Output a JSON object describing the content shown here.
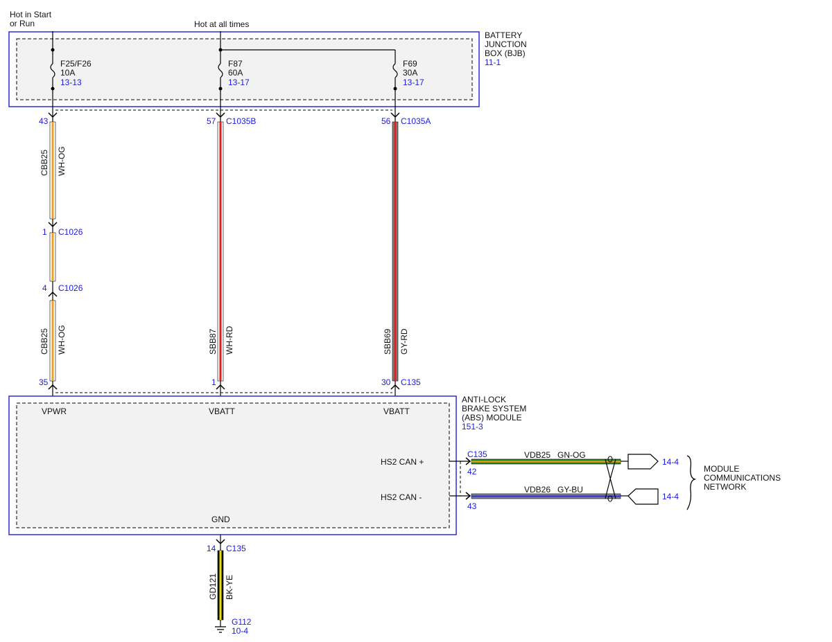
{
  "top_labels": {
    "hot_start_run_line1": "Hot in Start",
    "hot_start_run_line2": "or Run",
    "hot_all_times": "Hot at all times"
  },
  "bjb": {
    "name_line1": "BATTERY",
    "name_line2": "JUNCTION",
    "name_line3": "BOX (BJB)",
    "ref": "11-1",
    "fuses": [
      {
        "id": "F25/F26",
        "rating": "10A",
        "ref": "13-13"
      },
      {
        "id": "F87",
        "rating": "60A",
        "ref": "13-17"
      },
      {
        "id": "F69",
        "rating": "30A",
        "ref": "13-17"
      }
    ]
  },
  "circuits": [
    {
      "top_pin": "43",
      "connectors": [
        {
          "pin": "1",
          "name": "C1026"
        },
        {
          "pin": "4",
          "name": "C1026"
        }
      ],
      "upper": {
        "circuit": "CBB25",
        "color": "WH-OG"
      },
      "lower": {
        "circuit": "CBB25",
        "color": "WH-OG"
      },
      "bottom_pin": "35",
      "module_pin": "VPWR",
      "wire_colors": [
        "#ffffff",
        "#f0a020"
      ]
    },
    {
      "top_pin": "57",
      "top_connector": "C1035B",
      "lower": {
        "circuit": "SBB87",
        "color": "WH-RD"
      },
      "bottom_pin": "1",
      "module_pin": "VBATT",
      "wire_colors": [
        "#ffffff",
        "#e02020"
      ]
    },
    {
      "top_pin": "56",
      "top_connector": "C1035A",
      "lower": {
        "circuit": "SBB69",
        "color": "GY-RD"
      },
      "bottom_pin": "30",
      "bottom_connector": "C135",
      "module_pin": "VBATT",
      "wire_colors": [
        "#808080",
        "#e02020"
      ]
    }
  ],
  "abs": {
    "name_line1": "ANTI-LOCK",
    "name_line2": "BRAKE SYSTEM",
    "name_line3": "(ABS) MODULE",
    "ref": "151-3",
    "can_plus": "HS2 CAN +",
    "can_minus": "HS2 CAN -",
    "gnd": "GND"
  },
  "can": {
    "connector": "C135",
    "plus_pin": "42",
    "minus_pin": "43",
    "plus_circuit": "VDB25",
    "plus_color": "GN-OG",
    "minus_circuit": "VDB26",
    "minus_color": "GY-BU",
    "plus_ref": "14-4",
    "minus_ref": "14-4",
    "network_line1": "MODULE",
    "network_line2": "COMMUNICATIONS",
    "network_line3": "NETWORK",
    "plus_wire_colors": [
      "#2e8b1e",
      "#f0a020"
    ],
    "minus_wire_colors": [
      "#8080a0",
      "#3030c0"
    ]
  },
  "ground": {
    "pin": "14",
    "connector": "C135",
    "circuit": "GD121",
    "color": "BK-YE",
    "point": "G112",
    "ref": "10-4",
    "wire_colors": [
      "#111111",
      "#e8e000"
    ]
  }
}
